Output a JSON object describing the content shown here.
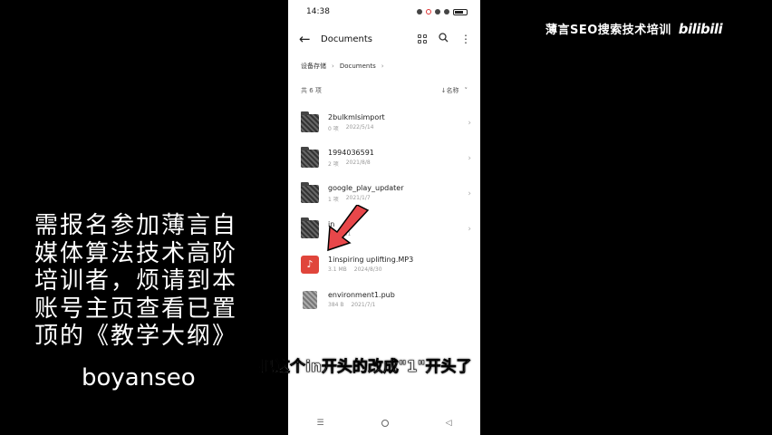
{
  "status": {
    "time": "14:38"
  },
  "header": {
    "title": "Documents"
  },
  "breadcrumb": {
    "root": "设备存储",
    "current": "Documents",
    "separator": "›"
  },
  "list": {
    "count_label": "共 6 项",
    "sort_label": "↓名称",
    "sort_chevron": "˅"
  },
  "files": [
    {
      "name": "2bulkmlsimport",
      "meta1": "0 项",
      "meta2": "2022/5/14",
      "type": "folder",
      "icon": "folder-icon"
    },
    {
      "name": "1994036591",
      "meta1": "2 项",
      "meta2": "2021/8/8",
      "type": "folder",
      "icon": "folder-icon"
    },
    {
      "name": "google_play_updater",
      "meta1": "1 项",
      "meta2": "2021/1/7",
      "type": "folder",
      "icon": "folder-icon"
    },
    {
      "name": "in",
      "meta1": "",
      "meta2": "08/31",
      "type": "folder",
      "icon": "folder-icon"
    },
    {
      "name": "1inspiring uplifting.MP3",
      "meta1": "3.1 MB",
      "meta2": "2024/8/30",
      "type": "audio",
      "icon": "music-file-icon",
      "glyph": "♪"
    },
    {
      "name": "environment1.pub",
      "meta1": "384 B",
      "meta2": "2021/7/1",
      "type": "document",
      "icon": "document-file-icon"
    }
  ],
  "overlay": {
    "brand": "薄言SEO搜索技术培训",
    "logo": "bilibili",
    "promo_lines": [
      "需报名参加薄言自",
      "媒体算法技术高阶",
      "培训者，烦请到本",
      "账号主页查看已置",
      "顶的《教学大纲》"
    ],
    "promo_handle": "boyanseo",
    "subtitle": "把这个in开头的改成\"1\"开头了"
  },
  "colors": {
    "audio": "#e0453b",
    "arrow": "#e8474a",
    "background": "#000000"
  }
}
